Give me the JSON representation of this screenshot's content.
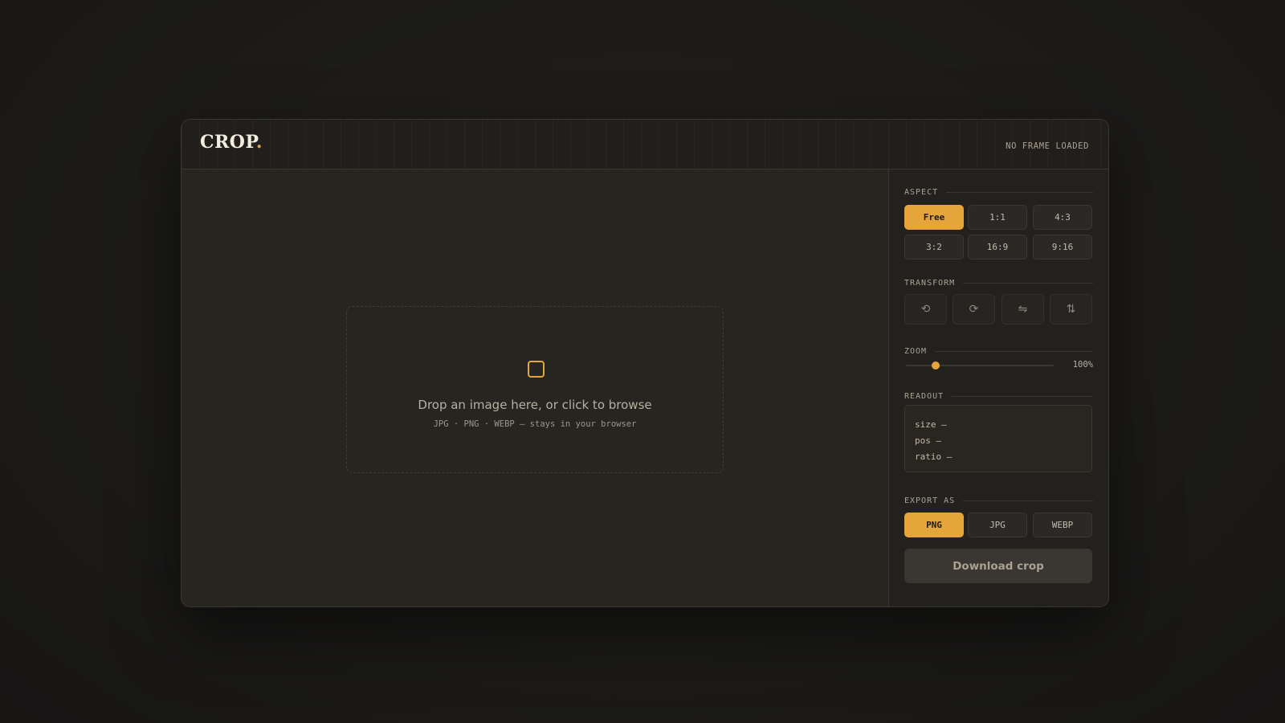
{
  "app": {
    "logo_text": "CROP",
    "logo_dot": ".",
    "status": "NO FRAME LOADED"
  },
  "dropzone": {
    "title": "Drop an image here, or click to browse",
    "subtitle": "JPG · PNG · WEBP — stays in your browser",
    "icon": "frame-icon"
  },
  "aspect": {
    "label": "ASPECT",
    "options": [
      "Free",
      "1:1",
      "4:3",
      "3:2",
      "16:9",
      "9:16"
    ],
    "selected": "Free"
  },
  "transform": {
    "label": "TRANSFORM",
    "buttons": [
      {
        "icon": "rotate-left-icon",
        "glyph": "⟲"
      },
      {
        "icon": "rotate-right-icon",
        "glyph": "⟳"
      },
      {
        "icon": "flip-horizontal-icon",
        "glyph": "⇋"
      },
      {
        "icon": "flip-vertical-icon",
        "glyph": "⇅"
      }
    ]
  },
  "zoom": {
    "label": "ZOOM",
    "value_text": "100%",
    "level_fraction": 0.2
  },
  "readout": {
    "label": "READOUT",
    "size": "size —",
    "pos": "pos —",
    "ratio": "ratio —"
  },
  "export": {
    "label": "EXPORT AS",
    "formats": [
      "PNG",
      "JPG",
      "WEBP"
    ],
    "selected": "PNG"
  },
  "download_label": "Download crop",
  "colors": {
    "accent": "#e6a53b",
    "background": "#1c1b19",
    "panel": "#23211e"
  }
}
